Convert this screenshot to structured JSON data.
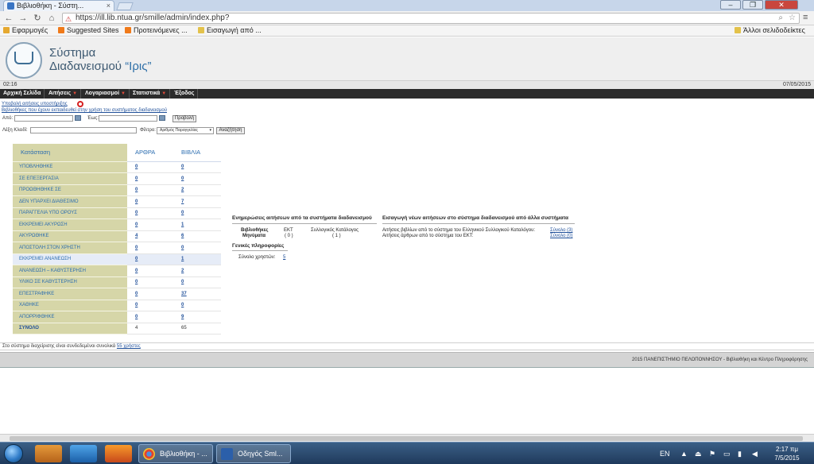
{
  "browser": {
    "tab_title": "Βιβλιοθήκη - Σύστη...",
    "url": "https://ill.lib.ntua.gr/smille/admin/index.php?",
    "bookmarks": [
      "Εφαρμογές",
      "Suggested Sites",
      "Προτεινόμενες ...",
      "Εισαγωγή από ..."
    ],
    "other_bookmarks": "Άλλοι σελιδοδείκτες"
  },
  "site": {
    "title_line1": "Σύστημα",
    "title_line2": "Διαδανεισμού",
    "title_brand": "“Ιρις”",
    "time": "02:16",
    "date": "07/05/2015"
  },
  "menu": [
    {
      "label": "Αρχική Σελίδα",
      "has_arrow": false
    },
    {
      "label": "Αιτήσεις",
      "has_arrow": true
    },
    {
      "label": "Λογαριασμοί",
      "has_arrow": true
    },
    {
      "label": "Στατιστικά",
      "has_arrow": true
    },
    {
      "label": "Έξοδος",
      "has_arrow": false
    }
  ],
  "search_form": {
    "submit_request": "Υποβολή αιτήσεις υποστήριξης",
    "libraries_note": "Βιβλιοθήκες που έχουν εκπαιδευθεί στην χρήση του συστήματος διαδανεισμού",
    "from_label": "Από:",
    "to_label": "Έως:",
    "show_button": "Προβολή",
    "keyword_label": "Λέξη Κλειδί:",
    "filter_label": "Φίλτρο:",
    "filter_value": "Αριθμός Παραγγελίας",
    "search_button": "Αναζήτηση"
  },
  "status_table": {
    "headers": {
      "status": "Κατάσταση",
      "articles": "ΑΡΘΡΑ",
      "books": "ΒΙΒΛΙΑ"
    },
    "rows": [
      {
        "label": "ΥΠΟΒΛΗΘΗΚΕ",
        "articles": "0",
        "books": "0"
      },
      {
        "label": "ΣΕ ΕΠΕΞΕΡΓΑΣΙΑ",
        "articles": "0",
        "books": "0"
      },
      {
        "label": "ΠΡΟΩΘΗΘΗΚΕ ΣΕ",
        "articles": "0",
        "books": "2"
      },
      {
        "label": "ΔΕΝ ΥΠΑΡΧΕΙ ΔΙΑΘΕΣΙΜΟ",
        "articles": "0",
        "books": "7"
      },
      {
        "label": "ΠΑΡΑΓΓΕΛΙΑ ΥΠΟ ΟΡΟΥΣ",
        "articles": "0",
        "books": "0"
      },
      {
        "label": "ΕΚΚΡΕΜΕΙ ΑΚΥΡΩΣΗ",
        "articles": "0",
        "books": "1"
      },
      {
        "label": "ΑΚΥΡΩΘΗΚΕ",
        "articles": "4",
        "books": "6"
      },
      {
        "label": "ΑΠΟΣΤΟΛΗ ΣΤΟΝ ΧΡΗΣΤΗ",
        "articles": "0",
        "books": "0"
      },
      {
        "label": "ΕΚΚΡΕΜΕΙ ΑΝΑΝΕΩΣΗ",
        "articles": "0",
        "books": "1"
      },
      {
        "label": "ΑΝΑΝΕΩΣΗ – ΚΑΘΥΣΤΕΡΗΣΗ",
        "articles": "0",
        "books": "2"
      },
      {
        "label": "ΥΛΙΚΟ ΣΕ ΚΑΘΥΣΤΕΡΗΣΗ",
        "articles": "0",
        "books": "0"
      },
      {
        "label": "ΕΠΕΣΤΡΑΦΗΚΕ",
        "articles": "0",
        "books": "37"
      },
      {
        "label": "ΧΑΘΗΚΕ",
        "articles": "0",
        "books": "0"
      },
      {
        "label": "ΑΠΟΡΡΙΦΘΗΚΕ",
        "articles": "0",
        "books": "9"
      }
    ],
    "total": {
      "label": "ΣΥΝΟΛΟ",
      "articles": "4",
      "books": "65"
    }
  },
  "updates": {
    "title": "Ενημερώσεις αιτήσεων από τα συστήματα διαδανεισμού",
    "row_label_l1": "Βιβλιοθήκες",
    "row_label_l2": "Μηνύματα",
    "ekt_label": "ΕΚΤ",
    "ekt_count": "( 0 )",
    "catalog_label": "Συλλογικός Κατάλογος",
    "catalog_count": "( 1 )"
  },
  "imports": {
    "title": "Εισαγωγή νέων αιτήσεων στο σύστημα διαδανεισμού από άλλα συστήματα",
    "line1": "Αιτήσεις βιβλίων από το σύστημα του Ελληνικού Συλλογικού Καταλόγου:",
    "line1_value": "Σύνολο (3)",
    "line2": "Αιτήσεις άρθρων από το σύστημα του ΕΚΤ:",
    "line2_value": "Σύνολο (0)"
  },
  "general": {
    "title": "Γενικές πληροφορίες",
    "users_label": "Σύνολο χρηστών:",
    "users_value": "5"
  },
  "footer": {
    "online_text": "Στο σύστημα διαχείρισης είναι συνδεδεμένοι συνολικά",
    "online_link": "55 χρήστες",
    "copyright": "2015 ΠΑΝΕΠΙΣΤΗΜΙΟ ΠΕΛΟΠΟΝΝΗΣΟΥ - Βιβλιοθήκη και Κέντρο Πληροφόρησης"
  },
  "taskbar": {
    "task1": "Βιβλιοθήκη - ...",
    "task2": "Οδηγός Sml...",
    "lang": "EN",
    "time": "2:17 πμ",
    "date": "7/5/2015"
  }
}
